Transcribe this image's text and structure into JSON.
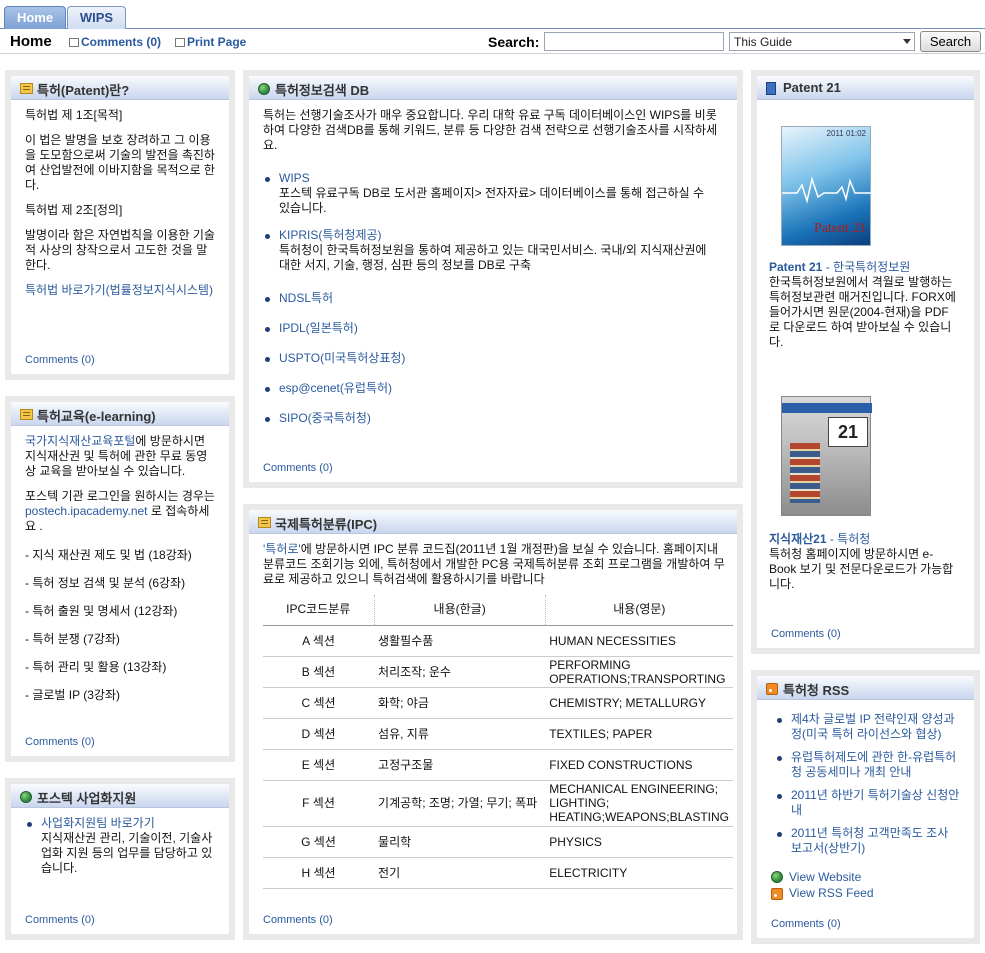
{
  "tabs": [
    {
      "label": "Home",
      "active": true
    },
    {
      "label": "WIPS",
      "active": false
    }
  ],
  "header": {
    "title": "Home",
    "comments_link": "Comments (0)",
    "print_link": "Print Page",
    "search_label": "Search:",
    "search_value": "",
    "scope_selected": "This Guide",
    "search_button": "Search"
  },
  "patent_def": {
    "title": "특허(Patent)란?",
    "p1": "특허법 제 1조[목적]",
    "p2": "이 법은 발명을 보호 장려하고 그 이용을 도모함으로써 기술의 발전을 촉진하여 산업발전에 이바지함을 목적으로 한다.",
    "p3": "특허법 제 2조[정의]",
    "p4": "발명이라 함은 자연법칙을 이용한 기술적 사상의 창작으로서 고도한 것을 말한다.",
    "link": "특허법 바로가기(법률정보지식시스템)",
    "comments": "Comments (0)"
  },
  "elearning": {
    "title": "특허교육(e-learning)",
    "intro_link": "국가지식재산교육포털",
    "intro_text": "에 방문하시면 지식재산권 및 특허에 관한 무료 동영상 교육을 받아보실 수 있습니다.",
    "login_text_1": "포스텍 기관 로그인을 원하시는 경우는 ",
    "login_link": "postech.ipacademy.net",
    "login_text_2": " 로 접속하세요 .",
    "courses": [
      "- 지식 재산권 제도 및 법 (18강좌)",
      "- 특허 정보 검색 및 분석 (6강좌)",
      "- 특허 출원 및 명세서 (12강좌)",
      "- 특허 분쟁 (7강좌)",
      "- 특허 관리 및 활용 (13강좌)",
      "- 글로벌 IP (3강좌)"
    ],
    "comments": "Comments (0)"
  },
  "biz": {
    "title": "포스텍 사업화지원",
    "item_link": "사업화지원팀 바로가기",
    "item_text": "지식재산권 관리, 기술이전, 기술사업화 지원 등의 업무를 담당하고 있습니다.",
    "comments": "Comments (0)"
  },
  "db": {
    "title": "특허정보검색 DB",
    "intro": "특허는 선행기술조사가 매우 중요합니다. 우리 대학 유료 구독 데이터베이스인 WIPS를 비롯하여 다양한 검색DB를 통해 키워드, 분류 등 다양한 검색 전략으로 선행기술조사를 시작하세요.",
    "items": [
      {
        "link": "WIPS",
        "desc": "포스텍 유료구독 DB로 도서관 홈페이지> 전자자료> 데이터베이스를 통해 접근하실 수 있습니다."
      },
      {
        "link": "KIPRIS(특허청제공)",
        "desc": "특허청이 한국특허정보원을 통하여 제공하고 있는 대국민서비스. 국내/외 지식재산권에 대한 서지, 기술, 행정, 심판 등의 정보를 DB로 구축"
      },
      {
        "link": "NDSL특허",
        "desc": ""
      },
      {
        "link": "IPDL(일본특허)",
        "desc": ""
      },
      {
        "link": "USPTO(미국특허상표청)",
        "desc": ""
      },
      {
        "link": "esp@cenet(유럽특허)",
        "desc": ""
      },
      {
        "link": "SIPO(중국특허청)",
        "desc": ""
      }
    ],
    "comments": "Comments (0)"
  },
  "ipc": {
    "title": "국제특허분류(IPC)",
    "intro_link": "'특허로'",
    "intro_text": "에 방문하시면 IPC 분류 코드집(2011년 1월 개정판)을 보실 수 있습니다. 홈페이지내 분류코드 조회기능 외에, 특허청에서 개발한 PC용 국제특허분류 조회 프로그램을 개발하여 무료로 제공하고 있으니 특허검색에 활용하시기를 바랍니다",
    "headers": [
      "IPC코드분류",
      "내용(한글)",
      "내용(영문)"
    ],
    "rows": [
      {
        "code": "A 섹션",
        "ko": "생활필수품",
        "en": "HUMAN NECESSITIES"
      },
      {
        "code": "B 섹션",
        "ko": "처리조작; 운수",
        "en": "PERFORMING OPERATIONS;TRANSPORTING"
      },
      {
        "code": "C 섹션",
        "ko": "화학; 야금",
        "en": "CHEMISTRY; METALLURGY"
      },
      {
        "code": "D 섹션",
        "ko": "섬유, 지류",
        "en": "TEXTILES; PAPER"
      },
      {
        "code": "E 섹션",
        "ko": "고정구조물",
        "en": "FIXED CONSTRUCTIONS"
      },
      {
        "code": "F 섹션",
        "ko": "기계공학; 조명; 가열; 무기; 폭파",
        "en": "MECHANICAL ENGINEERING; LIGHTING; HEATING;WEAPONS;BLASTING"
      },
      {
        "code": "G 섹션",
        "ko": "물리학",
        "en": "PHYSICS"
      },
      {
        "code": "H 섹션",
        "ko": "전기",
        "en": "ELECTRICITY"
      }
    ],
    "comments": "Comments (0)"
  },
  "patent21": {
    "title": "Patent 21",
    "cover1_title": "Patent 21",
    "cover1_date": "2011 01:02",
    "item1_link": "Patent 21",
    "item1_sub": " - 한국특허정보원",
    "item1_desc": "한국특허정보원에서 격월로 발행하는 특허정보관련 매거진입니다. FORX에 들어가시면 원문(2004-현재)을 PDF로 다운로드 하여 받아보실 수 있습니다.",
    "cover2_num": "21",
    "item2_link": "지식재산21",
    "item2_sub": " - 특허청",
    "item2_desc": "특허청 홈페이지에 방문하시면 e-Book 보기 및 전문다운로드가 가능합니다.",
    "comments": "Comments (0)"
  },
  "rss": {
    "title": "특허청 RSS",
    "items": [
      "제4차 글로벌 IP 전략인재 양성과정(미국 특허 라이선스와 협상)",
      "유럽특허제도에 관한 한-유럽특허청 공동세미나 개최 안내",
      "2011년 하반기 특허기술상 신청안내",
      "2011년 특허청 고객만족도 조사 보고서(상반기)"
    ],
    "view_website": "View Website",
    "view_rss": "View RSS Feed",
    "comments": "Comments (0)"
  }
}
